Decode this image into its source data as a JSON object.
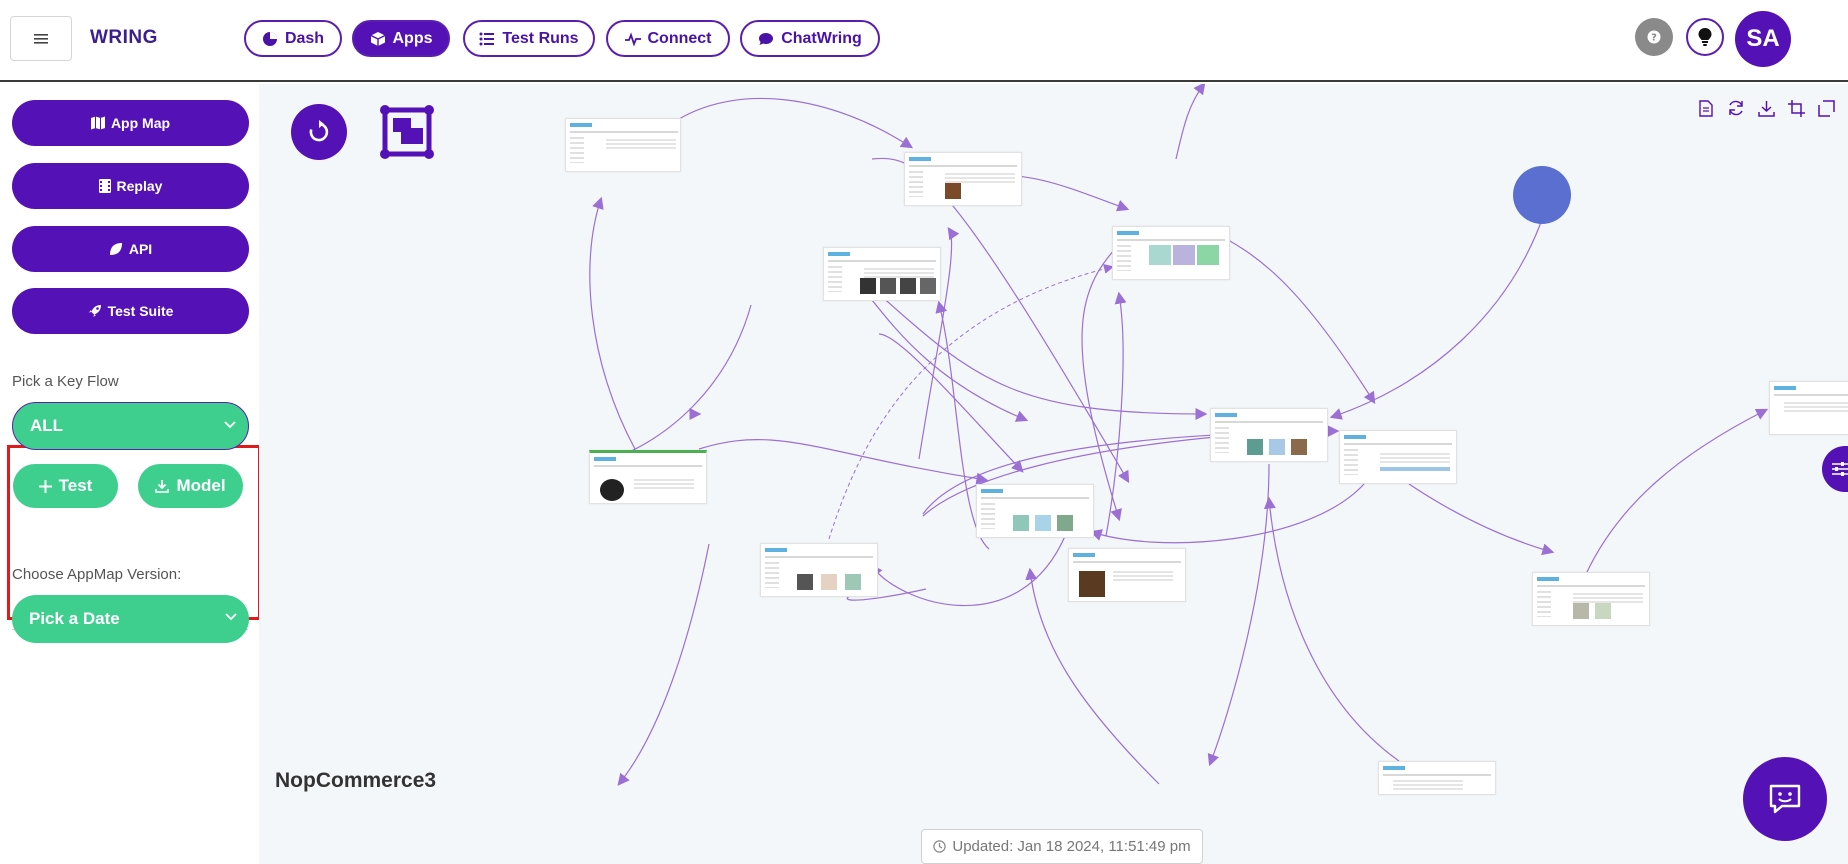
{
  "header": {
    "brand": "WRING",
    "nav": [
      {
        "label": "Dash",
        "icon": "pie-chart-icon",
        "active": false
      },
      {
        "label": "Apps",
        "icon": "cube-icon",
        "active": true
      },
      {
        "label": "Test Runs",
        "icon": "list-icon",
        "active": false
      },
      {
        "label": "Connect",
        "icon": "pulse-icon",
        "active": false
      },
      {
        "label": "ChatWring",
        "icon": "chat-bubble-icon",
        "active": false
      }
    ],
    "avatar_initials": "SA"
  },
  "sidebar": {
    "buttons": [
      {
        "label": "App Map",
        "icon": "map-icon"
      },
      {
        "label": "Replay",
        "icon": "film-icon"
      },
      {
        "label": "API",
        "icon": "leaf-icon"
      },
      {
        "label": "Test Suite",
        "icon": "rocket-icon"
      }
    ],
    "key_flow_label": "Pick a Key Flow",
    "key_flow_value": "ALL",
    "test_button": "Test",
    "model_button": "Model",
    "version_label": "Choose AppMap Version:",
    "version_value": "Pick a Date"
  },
  "canvas": {
    "app_name": "NopCommerce3",
    "updated": "Updated: Jan 18 2024, 11:51:49 pm"
  },
  "colors": {
    "primary": "#5411b5",
    "green": "#3ecf8e",
    "edge": "#9b6fd4",
    "highlight": "#e01b1b"
  }
}
